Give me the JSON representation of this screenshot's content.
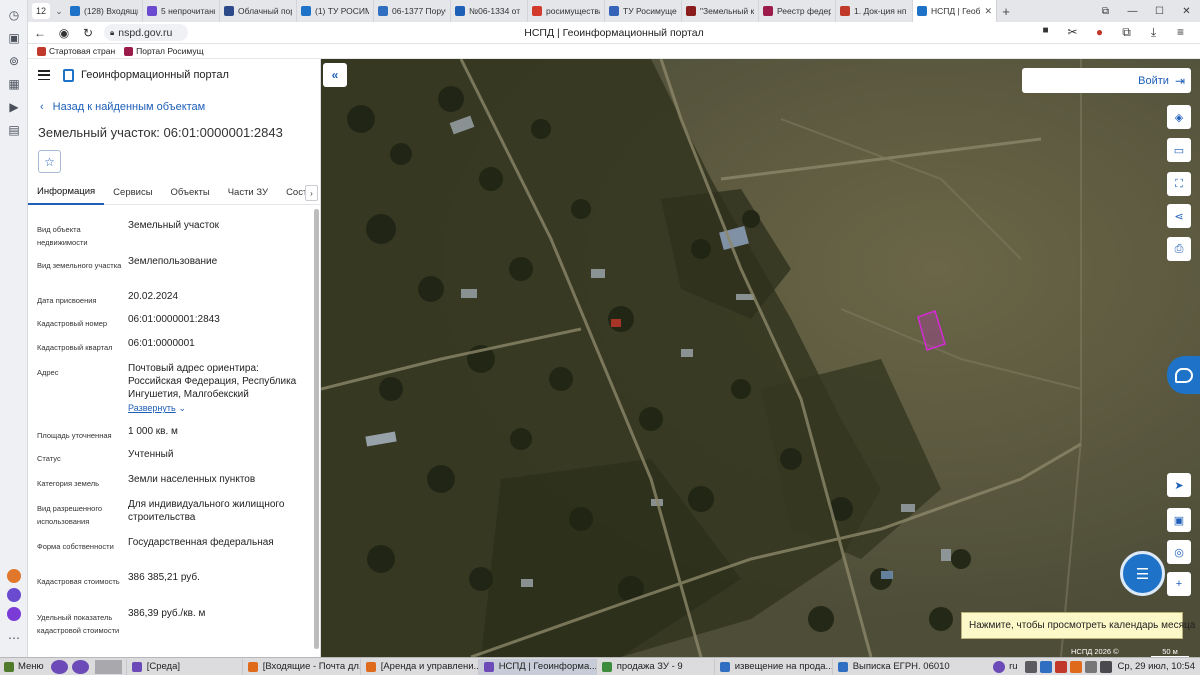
{
  "browser": {
    "tab_count": "12",
    "tabs": [
      {
        "label": "(128) Входящие",
        "color": "#1e73c8"
      },
      {
        "label": "5 непрочитанн",
        "color": "#6a4bd0"
      },
      {
        "label": "Облачный пор",
        "color": "#2c4a8a"
      },
      {
        "label": "(1) ТУ РОСИМ",
        "color": "#1e73c8"
      },
      {
        "label": "06-1377 Поруч",
        "color": "#2f6ec0"
      },
      {
        "label": "№06-1334 от 2",
        "color": "#1e5fb8"
      },
      {
        "label": "росимущества",
        "color": "#d23b2b"
      },
      {
        "label": "ТУ Росимущес",
        "color": "#3563b8"
      },
      {
        "label": "\"Земельный к",
        "color": "#8b1c1c"
      },
      {
        "label": "Реестр федер",
        "color": "#9b1b4a"
      },
      {
        "label": "1. Док-ция нп",
        "color": "#c0392b"
      }
    ],
    "active_tab": {
      "label": "НСПД | Геоб",
      "color": "#1e73c8"
    },
    "url": "nspd.gov.ru",
    "page_title": "НСПД | Геоинформационный портал",
    "bookmarks": [
      {
        "label": "Стартовая стран",
        "color": "#c0392b"
      },
      {
        "label": "Портал Росимущ",
        "color": "#9b1b4a"
      }
    ]
  },
  "panel": {
    "app_name": "Геоинформационный портал",
    "back_link": "Назад к найденным объектам",
    "object_title": "Земельный участок: 06:01:0000001:2843",
    "tabs": [
      {
        "label": "Информация",
        "active": true
      },
      {
        "label": "Сервисы",
        "active": false
      },
      {
        "label": "Объекты",
        "active": false
      },
      {
        "label": "Части ЗУ",
        "active": false
      },
      {
        "label": "Состав ЕЗП",
        "active": false
      }
    ],
    "fields": [
      {
        "label": "Вид объекта недвижимости",
        "value": "Земельный участок"
      },
      {
        "label": "Вид земельного участка",
        "value": "Землепользование"
      },
      {
        "label": "Дата присвоения",
        "value": "20.02.2024"
      },
      {
        "label": "Кадастровый номер",
        "value": "06:01:0000001:2843"
      },
      {
        "label": "Кадастровый квартал",
        "value": "06:01:0000001"
      },
      {
        "label": "Адрес",
        "value": "Почтовый адрес ориентира: Российская Федерация, Республика Ингушетия, Малгобекский"
      },
      {
        "label": "Площадь уточненная",
        "value": "1 000 кв. м"
      },
      {
        "label": "Статус",
        "value": "Учтенный"
      },
      {
        "label": "Категория земель",
        "value": "Земли населенных пунктов"
      },
      {
        "label": "Вид разрешенного использования",
        "value": "Для индивидуального жилищного строительства"
      },
      {
        "label": "Форма собственности",
        "value": "Государственная федеральная"
      },
      {
        "label": "Кадастровая стоимость",
        "value": "386 385,21 руб."
      },
      {
        "label": "Удельный показатель кадастровой стоимости",
        "value": "386,39 руб./кв. м"
      }
    ],
    "expand_label": "Развернуть"
  },
  "map": {
    "login_label": "Войти",
    "tooltip": "Нажмите, чтобы просмотреть календарь месяца",
    "copyright": "НСПД 2026 ©",
    "scale": "50 м",
    "parcel_color": "#d42bd4",
    "accent": "#1e73c8"
  },
  "taskbar": {
    "menu_label": "Меню",
    "items": [
      {
        "label": "[Среда]",
        "color": "#6c4bb8",
        "active": false
      },
      {
        "label": "[Входящие - Почта дл...",
        "color": "#e06a1b",
        "active": false
      },
      {
        "label": "[Аренда и управлени...",
        "color": "#e06a1b",
        "active": false
      },
      {
        "label": "НСПД | Геоинформа...",
        "color": "#6c4bb8",
        "active": true
      },
      {
        "label": "продажа ЗУ - 9",
        "color": "#3d8b3d",
        "active": false
      },
      {
        "label": "извещение на прода...",
        "color": "#2f6ec0",
        "active": false
      },
      {
        "label": "Выписка ЕГРН. 06010...",
        "color": "#2f6ec0",
        "active": false
      }
    ],
    "lang": "ru",
    "clock": "Ср, 29 июл, 10:54"
  }
}
